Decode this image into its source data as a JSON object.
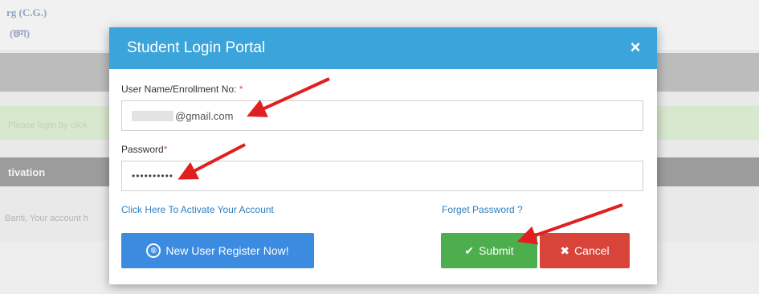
{
  "background": {
    "logo_line1": "rg (C.G.)",
    "logo_line2": "(छग)",
    "alert_text": "Please login by click",
    "section_heading": "tivation",
    "body_text": "Banti, Your account h"
  },
  "modal": {
    "title": "Student Login Portal",
    "close_icon": "×",
    "username_label": "User Name/Enrollment No:",
    "username_required": "*",
    "username_value": "@gmail.com",
    "password_label": "Password",
    "password_required": "*",
    "password_value": "••••••••••",
    "activate_link": "Click Here To Activate Your Account",
    "forgot_link": "Forget Password ?",
    "register_button": "New User Register Now!",
    "register_icon": "®",
    "submit_button": "Submit",
    "submit_icon": "✔",
    "cancel_button": "Cancel",
    "cancel_icon": "✖"
  },
  "colors": {
    "header": "#3ba4db",
    "register": "#3b8be0",
    "submit": "#4cae4c",
    "cancel": "#d9443a",
    "annotation": "#e02020"
  }
}
